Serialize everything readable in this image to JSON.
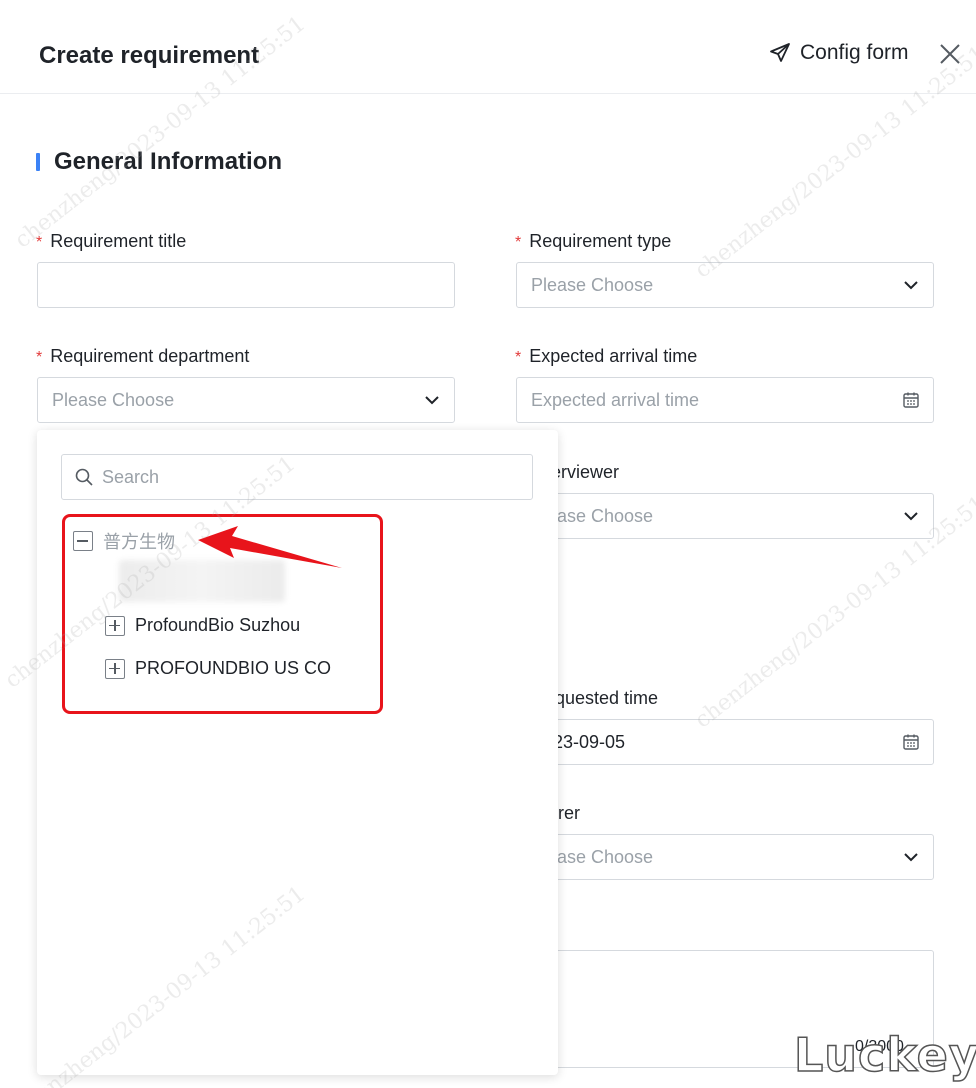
{
  "header": {
    "title": "Create requirement",
    "config_label": "Config form"
  },
  "section": {
    "title": "General Information",
    "accent": "#3b82f6"
  },
  "fields": {
    "requirement_title": {
      "label": "Requirement title",
      "value": ""
    },
    "requirement_type": {
      "label": "Requirement type",
      "placeholder": "Please Choose"
    },
    "requirement_department": {
      "label": "Requirement department",
      "placeholder": "Please Choose"
    },
    "expected_arrival_time": {
      "label": "Expected arrival time",
      "placeholder": "Expected arrival time"
    },
    "interviewer": {
      "label": "erviewer",
      "placeholder": "ase Choose"
    },
    "requested_time": {
      "label": "quested time",
      "value": "23-09-05"
    },
    "rer": {
      "label": "rer",
      "placeholder": "ase Choose"
    },
    "counter": "0/3000"
  },
  "dropdown": {
    "search_placeholder": "Search",
    "tree": [
      {
        "label": "普方生物",
        "expanded": true
      },
      {
        "label": "ProfoundBio Suzhou",
        "expanded": false
      },
      {
        "label": "PROFOUNDBIO US CO",
        "expanded": false
      }
    ],
    "highlight_color": "#e8141b"
  },
  "watermark_text": "chenzheng/2023-09-13 11:25:51",
  "brand_text": "Luckey"
}
